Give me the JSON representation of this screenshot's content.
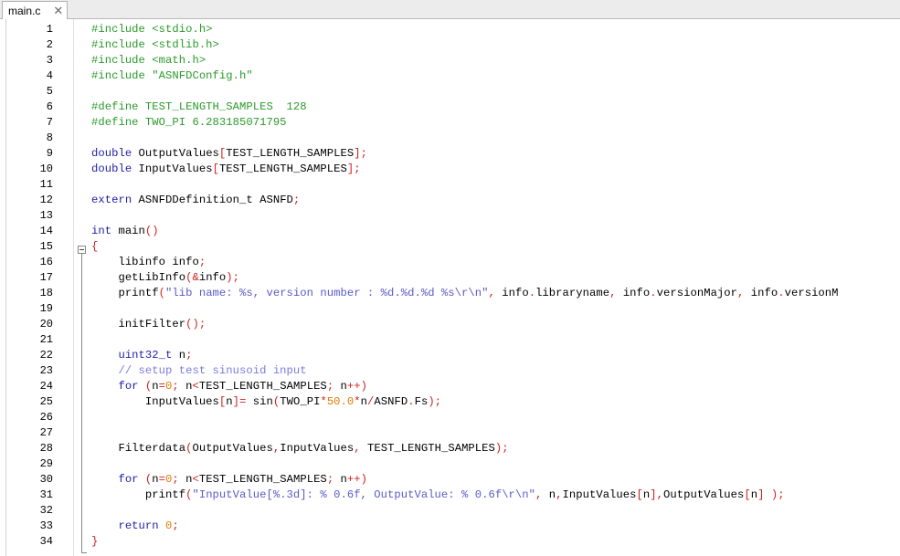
{
  "tab": {
    "title": "main.c",
    "close_glyph": "✕"
  },
  "editor": {
    "lines": [
      {
        "n": "1",
        "tokens": [
          [
            "pp",
            "#include <stdio.h>"
          ]
        ]
      },
      {
        "n": "2",
        "tokens": [
          [
            "pp",
            "#include <stdlib.h>"
          ]
        ]
      },
      {
        "n": "3",
        "tokens": [
          [
            "pp",
            "#include <math.h>"
          ]
        ]
      },
      {
        "n": "4",
        "tokens": [
          [
            "pp",
            "#include \"ASNFDConfig.h\""
          ]
        ]
      },
      {
        "n": "5",
        "tokens": []
      },
      {
        "n": "6",
        "tokens": [
          [
            "pp",
            "#define TEST_LENGTH_SAMPLES  128"
          ]
        ]
      },
      {
        "n": "7",
        "tokens": [
          [
            "pp",
            "#define TWO_PI 6.283185071795"
          ]
        ]
      },
      {
        "n": "8",
        "tokens": []
      },
      {
        "n": "9",
        "tokens": [
          [
            "kw",
            "double"
          ],
          [
            "id",
            " OutputValues"
          ],
          [
            "op",
            "["
          ],
          [
            "id",
            "TEST_LENGTH_SAMPLES"
          ],
          [
            "op",
            "];"
          ]
        ]
      },
      {
        "n": "10",
        "tokens": [
          [
            "kw",
            "double"
          ],
          [
            "id",
            " InputValues"
          ],
          [
            "op",
            "["
          ],
          [
            "id",
            "TEST_LENGTH_SAMPLES"
          ],
          [
            "op",
            "];"
          ]
        ]
      },
      {
        "n": "11",
        "tokens": []
      },
      {
        "n": "12",
        "tokens": [
          [
            "kw",
            "extern"
          ],
          [
            "id",
            " ASNFDDefinition_t ASNFD"
          ],
          [
            "op",
            ";"
          ]
        ]
      },
      {
        "n": "13",
        "tokens": []
      },
      {
        "n": "14",
        "tokens": [
          [
            "kw",
            "int"
          ],
          [
            "id",
            " main"
          ],
          [
            "op",
            "()"
          ]
        ]
      },
      {
        "n": "15",
        "tokens": [
          [
            "op",
            "{"
          ]
        ]
      },
      {
        "n": "16",
        "tokens": [
          [
            "id",
            "    libinfo info"
          ],
          [
            "op",
            ";"
          ]
        ]
      },
      {
        "n": "17",
        "tokens": [
          [
            "id",
            "    getLibInfo"
          ],
          [
            "op",
            "(&"
          ],
          [
            "id",
            "info"
          ],
          [
            "op",
            ");"
          ]
        ]
      },
      {
        "n": "18",
        "tokens": [
          [
            "id",
            "    printf"
          ],
          [
            "op",
            "("
          ],
          [
            "str",
            "\"lib name: %s, version number : %d.%d.%d %s\\r\\n\""
          ],
          [
            "op",
            ","
          ],
          [
            "id",
            " info"
          ],
          [
            "op",
            "."
          ],
          [
            "id",
            "libraryname"
          ],
          [
            "op",
            ","
          ],
          [
            "id",
            " info"
          ],
          [
            "op",
            "."
          ],
          [
            "id",
            "versionMajor"
          ],
          [
            "op",
            ","
          ],
          [
            "id",
            " info"
          ],
          [
            "op",
            "."
          ],
          [
            "id",
            "versionM"
          ]
        ]
      },
      {
        "n": "19",
        "tokens": []
      },
      {
        "n": "20",
        "tokens": [
          [
            "id",
            "    initFilter"
          ],
          [
            "op",
            "();"
          ]
        ]
      },
      {
        "n": "21",
        "tokens": []
      },
      {
        "n": "22",
        "tokens": [
          [
            "kw",
            "    uint32_t"
          ],
          [
            "id",
            " n"
          ],
          [
            "op",
            ";"
          ]
        ]
      },
      {
        "n": "23",
        "tokens": [
          [
            "cmt",
            "    // setup test sinusoid input"
          ]
        ]
      },
      {
        "n": "24",
        "tokens": [
          [
            "kw",
            "    for"
          ],
          [
            "op",
            " ("
          ],
          [
            "id",
            "n"
          ],
          [
            "op",
            "="
          ],
          [
            "num",
            "0"
          ],
          [
            "op",
            ";"
          ],
          [
            "id",
            " n"
          ],
          [
            "op",
            "<"
          ],
          [
            "id",
            "TEST_LENGTH_SAMPLES"
          ],
          [
            "op",
            ";"
          ],
          [
            "id",
            " n"
          ],
          [
            "op",
            "++)"
          ]
        ]
      },
      {
        "n": "25",
        "tokens": [
          [
            "id",
            "        InputValues"
          ],
          [
            "op",
            "["
          ],
          [
            "id",
            "n"
          ],
          [
            "op",
            "]="
          ],
          [
            "id",
            " sin"
          ],
          [
            "op",
            "("
          ],
          [
            "id",
            "TWO_PI"
          ],
          [
            "op",
            "*"
          ],
          [
            "num",
            "50.0"
          ],
          [
            "op",
            "*"
          ],
          [
            "id",
            "n"
          ],
          [
            "op",
            "/"
          ],
          [
            "id",
            "ASNFD"
          ],
          [
            "op",
            "."
          ],
          [
            "id",
            "Fs"
          ],
          [
            "op",
            ");"
          ]
        ]
      },
      {
        "n": "26",
        "tokens": []
      },
      {
        "n": "27",
        "tokens": []
      },
      {
        "n": "28",
        "tokens": [
          [
            "id",
            "    Filterdata"
          ],
          [
            "op",
            "("
          ],
          [
            "id",
            "OutputValues"
          ],
          [
            "op",
            ","
          ],
          [
            "id",
            "InputValues"
          ],
          [
            "op",
            ","
          ],
          [
            "id",
            " TEST_LENGTH_SAMPLES"
          ],
          [
            "op",
            ");"
          ]
        ]
      },
      {
        "n": "29",
        "tokens": []
      },
      {
        "n": "30",
        "tokens": [
          [
            "kw",
            "    for"
          ],
          [
            "op",
            " ("
          ],
          [
            "id",
            "n"
          ],
          [
            "op",
            "="
          ],
          [
            "num",
            "0"
          ],
          [
            "op",
            ";"
          ],
          [
            "id",
            " n"
          ],
          [
            "op",
            "<"
          ],
          [
            "id",
            "TEST_LENGTH_SAMPLES"
          ],
          [
            "op",
            ";"
          ],
          [
            "id",
            " n"
          ],
          [
            "op",
            "++)"
          ]
        ]
      },
      {
        "n": "31",
        "tokens": [
          [
            "id",
            "        printf"
          ],
          [
            "op",
            "("
          ],
          [
            "str",
            "\"InputValue[%.3d]: % 0.6f, OutputValue: % 0.6f\\r\\n\""
          ],
          [
            "op",
            ","
          ],
          [
            "id",
            " n"
          ],
          [
            "op",
            ","
          ],
          [
            "id",
            "InputValues"
          ],
          [
            "op",
            "["
          ],
          [
            "id",
            "n"
          ],
          [
            "op",
            "],"
          ],
          [
            "id",
            "OutputValues"
          ],
          [
            "op",
            "["
          ],
          [
            "id",
            "n"
          ],
          [
            "op",
            "]"
          ],
          [
            "op",
            " );"
          ]
        ]
      },
      {
        "n": "32",
        "tokens": []
      },
      {
        "n": "33",
        "tokens": [
          [
            "kw",
            "    return"
          ],
          [
            "num",
            " 0"
          ],
          [
            "op",
            ";"
          ]
        ]
      },
      {
        "n": "34",
        "tokens": [
          [
            "op",
            "}"
          ]
        ]
      }
    ]
  }
}
